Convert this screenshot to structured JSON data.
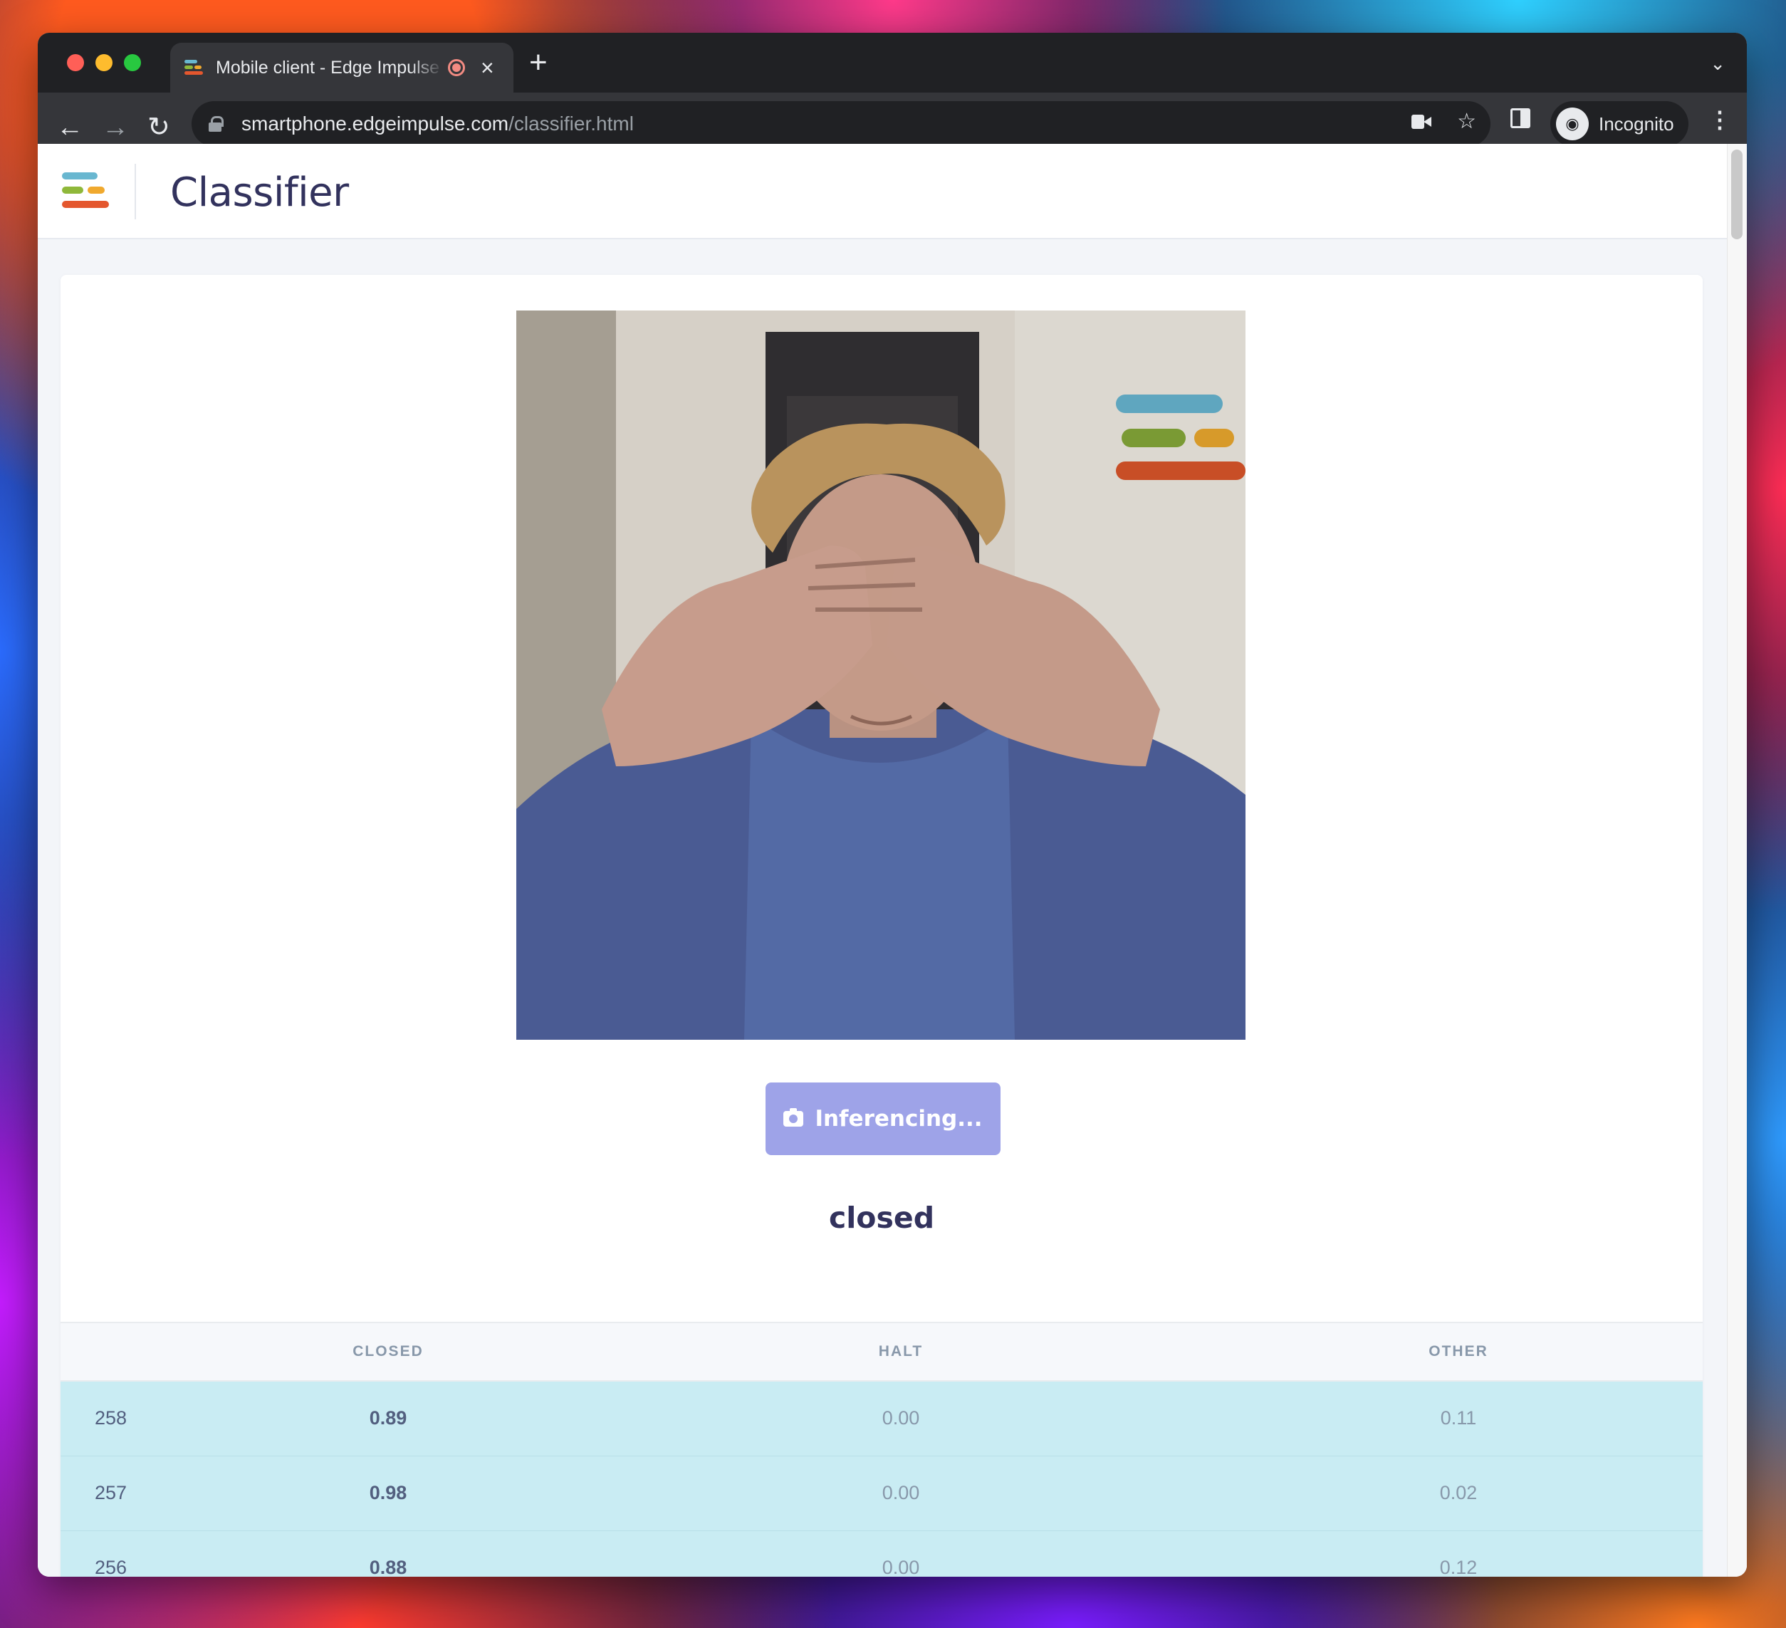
{
  "browser": {
    "tab_title": "Mobile client - Edge Impulse",
    "tab_close": "×",
    "new_tab": "+",
    "tab_menu": "⌄",
    "url_host": "smartphone.edgeimpulse.com",
    "url_path": "/classifier.html",
    "profile_label": "Incognito",
    "icons": [
      "back-arrow-icon",
      "forward-arrow-icon",
      "reload-icon",
      "lock-icon",
      "camera-in-use-icon",
      "bookmark-star-icon",
      "side-panel-icon",
      "incognito-icon",
      "menu-kebab-icon"
    ]
  },
  "app": {
    "title": "Classifier",
    "brand_colors": [
      "#69b7d0",
      "#8fb83a",
      "#f0a92e",
      "#e4572e"
    ]
  },
  "classifier": {
    "button_label": "Inferencing...",
    "result": "closed",
    "columns": [
      "",
      "CLOSED",
      "HALT",
      "OTHER"
    ],
    "rows": [
      {
        "index": "258",
        "closed": "0.89",
        "halt": "0.00",
        "other": "0.11"
      },
      {
        "index": "257",
        "closed": "0.98",
        "halt": "0.00",
        "other": "0.02"
      },
      {
        "index": "256",
        "closed": "0.88",
        "halt": "0.00",
        "other": "0.12"
      }
    ],
    "accent": "#9ea3e8",
    "row_highlight": "#c9ecf3"
  }
}
